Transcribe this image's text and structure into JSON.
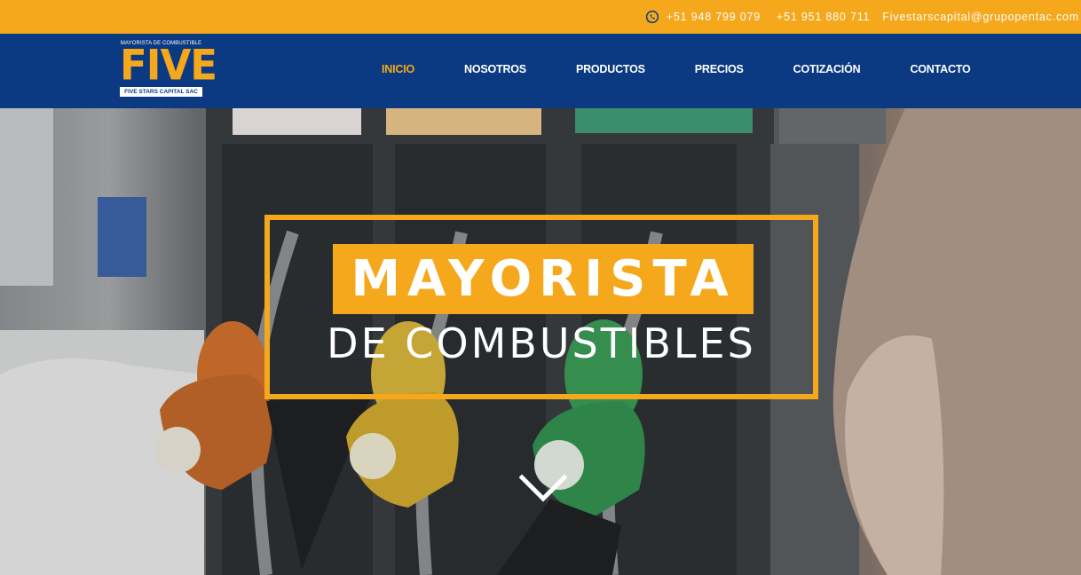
{
  "topbar": {
    "phone1": "+51 948 799 079",
    "phone2": "+51 951 880 711",
    "email": "Fivestarscapital@grupopentac.com",
    "icon": "whatsapp-icon",
    "background": "#f5a81c"
  },
  "logo": {
    "tagline": "MAYORISTA DE COMBUSTIBLE",
    "brand": "FIVE",
    "company": "FIVE STARS CAPITAL SAC"
  },
  "nav": {
    "background": "#0b3a82",
    "active_color": "#f5a81c",
    "items": [
      {
        "label": "INICIO",
        "active": true
      },
      {
        "label": "NOSOTROS",
        "active": false
      },
      {
        "label": "PRODUCTOS",
        "active": false
      },
      {
        "label": "PRECIOS",
        "active": false
      },
      {
        "label": "COTIZACIÓN",
        "active": false
      },
      {
        "label": "CONTACTO",
        "active": false
      }
    ]
  },
  "hero": {
    "title_line1": "MAYORISTA",
    "title_line2": "DE COMBUSTIBLES",
    "scroll_icon": "chevron-down-icon",
    "accent": "#f5a81c"
  }
}
